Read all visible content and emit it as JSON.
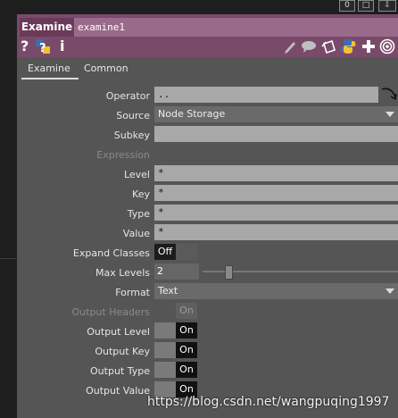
{
  "window_buttons": {
    "b1": "0",
    "b2": "□",
    "b3": "⇩"
  },
  "header": {
    "op_type": "Examine",
    "op_name": "examine1"
  },
  "icons": [
    "help-icon",
    "python-help-icon",
    "info-icon",
    "edit-icon",
    "comment-icon",
    "clone-icon",
    "python-icon",
    "add-icon",
    "viewer-icon"
  ],
  "tabs": [
    {
      "label": "Examine",
      "active": true
    },
    {
      "label": "Common",
      "active": false
    }
  ],
  "params": {
    "operator": {
      "label": "Operator",
      "value": ".."
    },
    "source": {
      "label": "Source",
      "value": "Node Storage"
    },
    "subkey": {
      "label": "Subkey",
      "value": ""
    },
    "expression": {
      "label": "Expression"
    },
    "level": {
      "label": "Level",
      "value": "*"
    },
    "key": {
      "label": "Key",
      "value": "*"
    },
    "type": {
      "label": "Type",
      "value": "*"
    },
    "value": {
      "label": "Value",
      "value": "*"
    },
    "expand_classes": {
      "label": "Expand Classes",
      "value": "Off"
    },
    "max_levels": {
      "label": "Max Levels",
      "value": "2",
      "slider_fraction": 0.12
    },
    "format": {
      "label": "Format",
      "value": "Text"
    },
    "output_headers": {
      "label": "Output Headers",
      "value": "On",
      "enabled": false
    },
    "output_level": {
      "label": "Output Level",
      "value": "On"
    },
    "output_key": {
      "label": "Output Key",
      "value": "On"
    },
    "output_type": {
      "label": "Output Type",
      "value": "On"
    },
    "output_value": {
      "label": "Output Value",
      "value": "On"
    }
  },
  "watermark": "https://blog.csdn.net/wangpuqing1997"
}
